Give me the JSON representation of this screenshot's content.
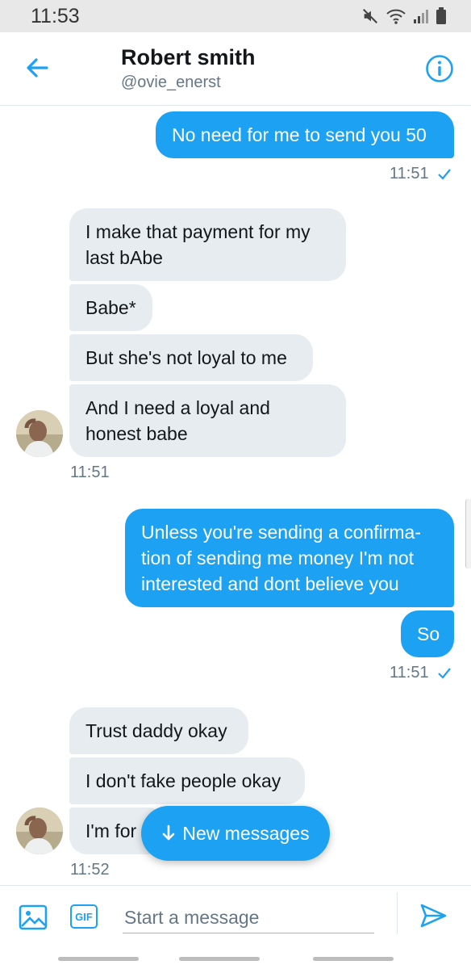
{
  "status_bar": {
    "time": "11:53"
  },
  "header": {
    "name": "Robert smith",
    "handle": "@ovie_enerst"
  },
  "messages": {
    "m1": "No need for me to send you 50",
    "m1_time": "11:51",
    "m2": "I make that payment for my\nlast bAbe",
    "m3": "Babe*",
    "m4": "But she's not loyal to me",
    "m5": "And I need a loyal and\nhonest babe",
    "m5_time": "11:51",
    "m6": "Unless you're sending a confirma-\ntion of sending me money I'm not\ninterested and dont believe you",
    "m7": "So",
    "m7_time": "11:51",
    "m8": "Trust daddy okay",
    "m9": "I don't fake people okay",
    "m10": "I'm for",
    "m10_time": "11:52"
  },
  "new_messages_label": "New messages",
  "composer": {
    "placeholder": "Start a message",
    "gif_label": "GIF"
  },
  "colors": {
    "accent": "#1da1f2",
    "received_bg": "#e6ecf0",
    "meta": "#657786"
  }
}
